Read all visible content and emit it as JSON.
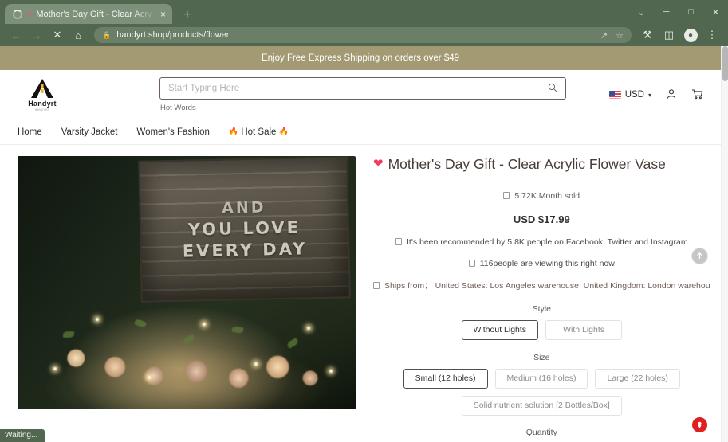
{
  "browser": {
    "tab": {
      "title": "Mother's Day Gift - Clear Acry",
      "favicon_label": "heart-favicon",
      "close_label": "×",
      "loading": true
    },
    "new_tab_label": "+",
    "window_controls": {
      "tab_search": "⌄",
      "minimize": "─",
      "maximize": "□",
      "close": "✕"
    },
    "toolbar": {
      "back": "←",
      "forward": "→",
      "stop": "✕",
      "home": "⌂",
      "lock": "🔒",
      "url": "handyrt.shop/products/flower",
      "share": "⤴",
      "bookmark": "☆",
      "extensions": "🧩",
      "sidepanel": "◱",
      "profile": "👤",
      "menu": "⋮"
    },
    "status_text": "Waiting..."
  },
  "promo": {
    "text": "Enjoy Free Express Shipping on orders over $49"
  },
  "header": {
    "logo": {
      "name": "Handyrt",
      "subtitle": "HANDYRT"
    },
    "search": {
      "placeholder": "Start Typing Here",
      "value": "",
      "icon": "search-icon",
      "hot_words_label": "Hot Words"
    },
    "currency": {
      "code": "USD",
      "flag": "us-flag",
      "chevron": "⌄"
    },
    "account_icon": "♁",
    "cart_icon": "☗"
  },
  "nav": {
    "items": [
      {
        "label": "Home"
      },
      {
        "label": "Varsity Jacket"
      },
      {
        "label": "Women's Fashion"
      },
      {
        "label": "Hot Sale",
        "fire": "🔥",
        "hot": true
      }
    ]
  },
  "product": {
    "image": {
      "sign_top": "AND",
      "sign_line1": "YOU LOVE",
      "sign_line2": "EVERY DAY",
      "alt": "flower-vase-product-photo"
    },
    "heart": "💗",
    "title": "Mother's Day Gift - Clear Acrylic Flower Vase",
    "month_sold": "5.72K Month sold",
    "price": "USD $17.99",
    "recommended": "It's been recommended by 5.8K people on Facebook, Twitter and Instagram",
    "viewing": "116people are viewing this right now",
    "ships_from": "Ships from：  United States: Los Angeles warehouse. United Kingdom: London warehou",
    "style": {
      "label": "Style",
      "options": [
        {
          "label": "Without Lights",
          "selected": true
        },
        {
          "label": "With Lights",
          "selected": false
        }
      ]
    },
    "size": {
      "label": "Size",
      "options": [
        {
          "label": "Small (12 holes)",
          "selected": true
        },
        {
          "label": "Medium (16 holes)",
          "selected": false
        },
        {
          "label": "Large (22 holes)",
          "selected": false
        },
        {
          "label": "Solid nutrient solution [2 Bottles/Box]",
          "selected": false
        }
      ]
    },
    "quantity_label": "Quantity"
  },
  "floating": {
    "scroll_top_icon": "↑",
    "badge_icon": "♁"
  },
  "colors": {
    "chrome": "#52674f",
    "promo": "#a39a74",
    "accent_heart": "#ef3b62",
    "badge_red": "#e02020"
  }
}
